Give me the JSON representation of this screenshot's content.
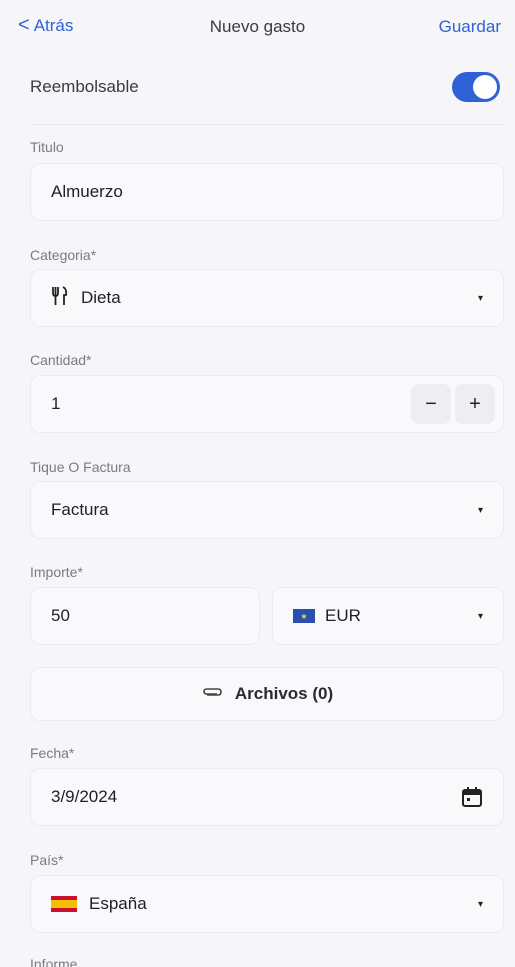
{
  "header": {
    "back_label": "Atrás",
    "back_chevron": "<",
    "title": "Nuevo gasto",
    "save_label": "Guardar"
  },
  "reimbursable": {
    "label": "Reembolsable",
    "enabled": true,
    "accent_color": "#2f62d6"
  },
  "form": {
    "title_label": "Titulo",
    "title_value": "Almuerzo",
    "category_label": "Categoria*",
    "category_icon": "fork-knife-icon",
    "category_value": "Dieta",
    "quantity_label": "Cantidad*",
    "quantity_value": "1",
    "quantity_minus": "−",
    "quantity_plus": "+",
    "receipt_label": "Tique O Factura",
    "receipt_value": "Factura",
    "amount_label": "Importe*",
    "amount_value": "50",
    "currency_value": "EUR",
    "files_label": "Archivos (0)",
    "date_label": "Fecha*",
    "date_value": "3/9/2024",
    "country_label": "País*",
    "country_value": "España",
    "report_label": "Informe"
  },
  "icons": {
    "caret": "▾",
    "clip": "⊘"
  }
}
